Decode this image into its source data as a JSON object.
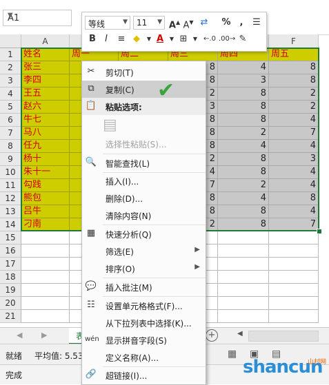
{
  "name_box": {
    "value": "A1"
  },
  "mini_toolbar": {
    "font_name": "等线",
    "font_size": "11",
    "percent_icon": "%",
    "comma_icon": ","
  },
  "columns": [
    "A",
    "B",
    "C",
    "D",
    "E",
    "F"
  ],
  "rows": [
    "1",
    "2",
    "3",
    "4",
    "5",
    "6",
    "7",
    "8",
    "9",
    "10",
    "11",
    "12",
    "13",
    "14",
    "15",
    "16",
    "17",
    "18",
    "19",
    "20",
    "21"
  ],
  "headers": [
    "姓名",
    "周一",
    "周二",
    "周三",
    "周四",
    "周五"
  ],
  "names": [
    "张三",
    "李四",
    "王五",
    "赵六",
    "牛七",
    "马八",
    "任九",
    "杨十",
    "朱十一",
    "勾践",
    "熊包",
    "吕牛",
    "刁南"
  ],
  "col_d": [
    "8",
    "8",
    "2",
    "3",
    "8",
    "8",
    "8",
    "2",
    "4",
    "7",
    "8",
    "8",
    "2"
  ],
  "col_e": [
    "4",
    "3",
    "8",
    "8",
    "8",
    "2",
    "4",
    "8",
    "8",
    "2",
    "4",
    "8",
    "8"
  ],
  "col_f": [
    "8",
    "8",
    "2",
    "2",
    "4",
    "7",
    "4",
    "3",
    "4",
    "4",
    "8",
    "4",
    "7"
  ],
  "context_menu": {
    "cut": "剪切(T)",
    "copy": "复制(C)",
    "paste_options": "粘贴选项:",
    "paste_special": "选择性粘贴(S)...",
    "smart_lookup": "智能查找(L)",
    "insert": "插入(I)...",
    "delete": "删除(D)...",
    "clear": "清除内容(N)",
    "quick_analysis": "快速分析(Q)",
    "filter": "筛选(E)",
    "sort": "排序(O)",
    "insert_comment": "插入批注(M)",
    "format_cells": "设置单元格格式(F)...",
    "pick_list": "从下拉列表中选择(K)...",
    "phonetic": "显示拼音字段(S)",
    "define_name": "定义名称(A)...",
    "hyperlink": "超链接(I)..."
  },
  "status": {
    "ready": "就绪",
    "average": "平均值: 5.53",
    "done": "完成",
    "sheet_tab": "表"
  },
  "watermark": {
    "text": "shancun",
    "sub": "山村网"
  },
  "colors": {
    "selection": "#cdcd00",
    "header_text": "#d40000",
    "check": "#3aa53a"
  }
}
